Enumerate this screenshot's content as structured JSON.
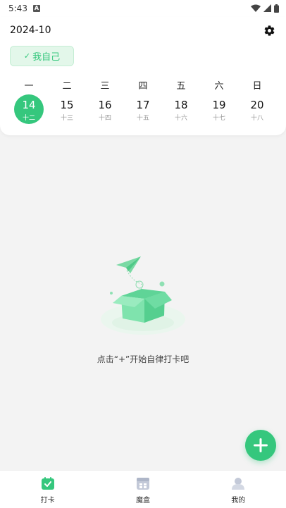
{
  "status_bar": {
    "time": "5:43",
    "notification_badge": "A"
  },
  "header": {
    "month": "2024-10",
    "settings_icon": "gear-icon"
  },
  "profile_chip": {
    "check": "✓",
    "label": "我自己"
  },
  "calendar": {
    "weekdays": [
      "一",
      "二",
      "三",
      "四",
      "五",
      "六",
      "日"
    ],
    "days": [
      {
        "day": "14",
        "lunar": "十二",
        "selected": true
      },
      {
        "day": "15",
        "lunar": "十三",
        "selected": false
      },
      {
        "day": "16",
        "lunar": "十四",
        "selected": false
      },
      {
        "day": "17",
        "lunar": "十五",
        "selected": false
      },
      {
        "day": "18",
        "lunar": "十六",
        "selected": false
      },
      {
        "day": "19",
        "lunar": "十七",
        "selected": false
      },
      {
        "day": "20",
        "lunar": "十八",
        "selected": false
      }
    ]
  },
  "empty_state": {
    "message": "点击“+”开始自律打卡吧"
  },
  "fab": {
    "icon": "plus-icon"
  },
  "bottom_nav": [
    {
      "label": "打卡",
      "icon": "checkin-icon",
      "active": true
    },
    {
      "label": "魔盒",
      "icon": "grid-box-icon",
      "active": false
    },
    {
      "label": "我的",
      "icon": "profile-icon",
      "active": false
    }
  ],
  "colors": {
    "accent": "#35c77d",
    "chip_bg": "#e3f7ea",
    "page_bg": "#f3f3f3",
    "nav_inactive": "#b8bfd0"
  }
}
